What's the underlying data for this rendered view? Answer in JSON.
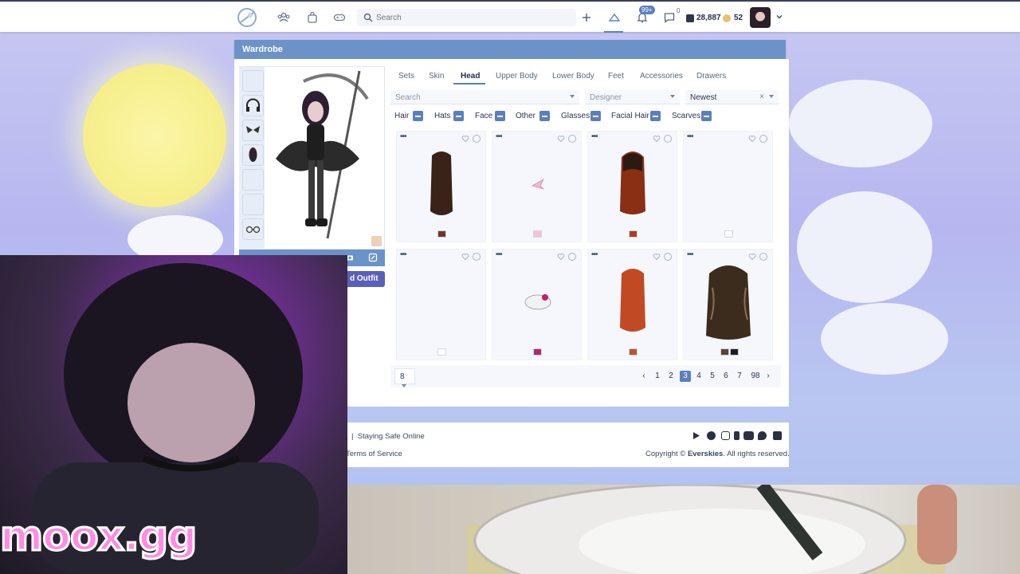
{
  "topbar": {
    "search_placeholder": "Search",
    "notifications_badge": "99+",
    "messages_badge": "0",
    "gems": "28,887",
    "coins": "52",
    "colors": {
      "accent": "#5b7fbe",
      "bar_border": "#3b3f58"
    }
  },
  "wardrobe": {
    "title": "Wardrobe",
    "save_button": "d Outfit",
    "tabs": [
      "Sets",
      "Skin",
      "Head",
      "Upper Body",
      "Lower Body",
      "Feet",
      "Accessories",
      "Drawers"
    ],
    "active_tab": "Head",
    "search_placeholder": "Search",
    "designer_placeholder": "Designer",
    "sort_value": "Newest",
    "filters": [
      "Hair",
      "Hats",
      "Face",
      "Other",
      "Glasses",
      "Facial Hair",
      "Scarves"
    ],
    "items": [
      {
        "icon": "hair-dark-long-icon",
        "swatch": "#6b3a22"
      },
      {
        "icon": "bow-icon",
        "swatch": "#f2c3d2"
      },
      {
        "icon": "hair-auburn-icon",
        "swatch": "#a8401c"
      },
      {
        "icon": "empty-item-icon",
        "swatch": "#ffffff"
      },
      {
        "icon": "empty-item-icon",
        "swatch": "#ffffff"
      },
      {
        "icon": "kitty-mask-icon",
        "swatch": "#b22a6a"
      },
      {
        "icon": "hair-red-icon",
        "swatch": "#c2502a"
      },
      {
        "icon": "hair-curly-brown-icon",
        "swatch": "#4a3a2a"
      }
    ],
    "per_page": "8",
    "pages": [
      "1",
      "2",
      "3",
      "4",
      "5",
      "6",
      "7",
      "98"
    ],
    "current_page": "3",
    "colors": {
      "header": "#6b93c8",
      "save": "#5a5fba"
    }
  },
  "footer": {
    "links_left": "s  |  Staying Safe Online",
    "terms": "Terms of Service",
    "copyright_prefix": "Copyright © ",
    "copyright_brand": "Everskies",
    "copyright_suffix": ". All rights reserved.",
    "social_icons": [
      "google-play-icon",
      "apple-icon",
      "instagram-icon",
      "tumblr-icon",
      "youtube-icon",
      "twitter-icon",
      "discord-icon"
    ]
  },
  "overlay": {
    "brand_text": "moox.gg"
  }
}
